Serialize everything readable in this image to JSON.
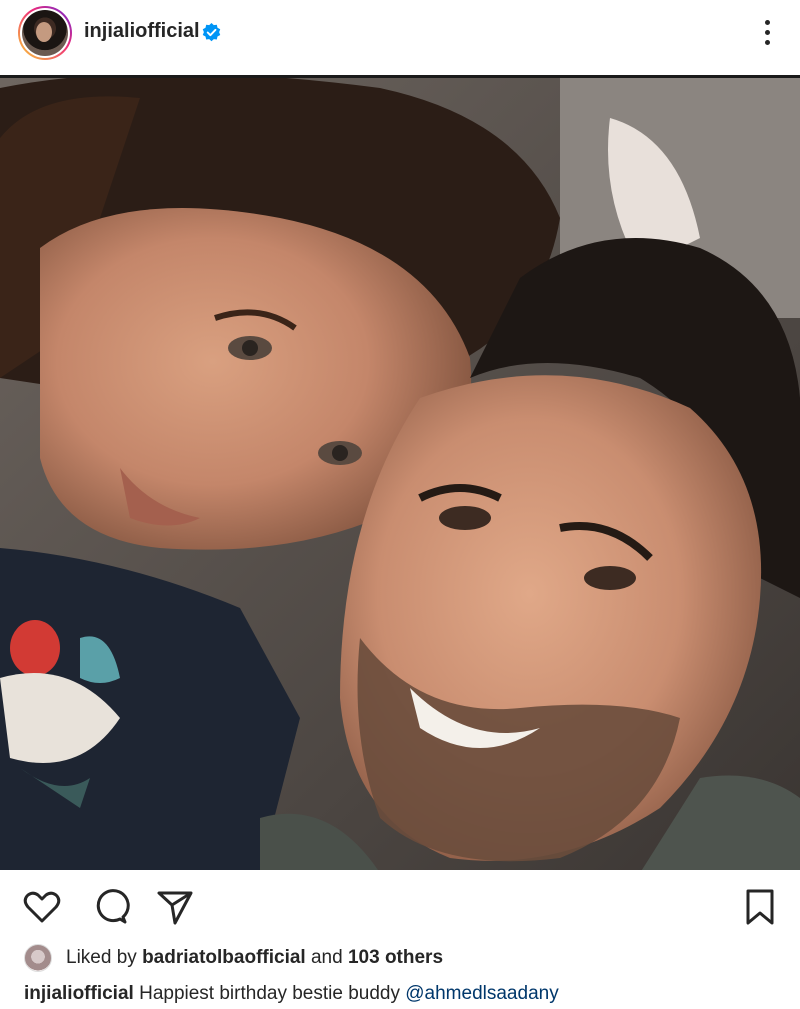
{
  "post": {
    "username": "injialiofficial",
    "verified": true,
    "more_icon": "more-vertical-icon"
  },
  "photo": {
    "user_tag_icon": "user-tag-icon"
  },
  "actions": {
    "like_icon": "heart-icon",
    "comment_icon": "comment-icon",
    "share_icon": "send-icon",
    "save_icon": "bookmark-icon"
  },
  "likes": {
    "prefix": "Liked by",
    "liker": "badriatolbaofficial",
    "connector": "and",
    "others": "103 others"
  },
  "caption": {
    "username": "injialiofficial",
    "text": "Happiest birthday bestie buddy",
    "mention": "@ahmedlsaadany"
  },
  "colors": {
    "verified_blue": "#0095f6",
    "mention_blue": "#00376b",
    "text": "#262626"
  }
}
